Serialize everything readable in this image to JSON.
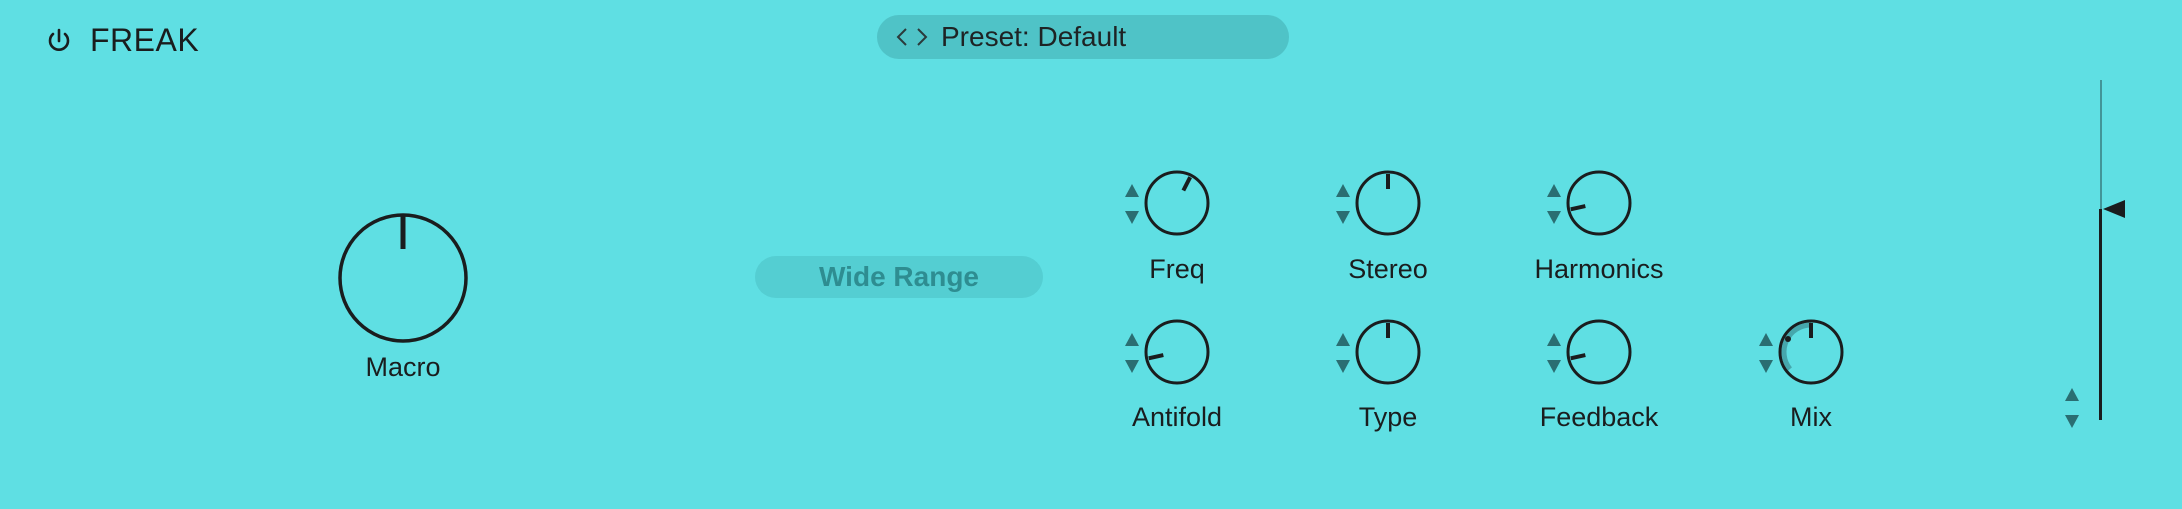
{
  "header": {
    "app_title": "FREAK",
    "preset_label": "Preset: Default"
  },
  "macro": {
    "label": "Macro",
    "value": 0.5
  },
  "wide_range": {
    "label": "Wide Range"
  },
  "knobs": {
    "freq": {
      "label": "Freq",
      "value": 0.6
    },
    "stereo": {
      "label": "Stereo",
      "value": 0.5
    },
    "harmonics": {
      "label": "Harmonics",
      "value": 0.12
    },
    "antifold": {
      "label": "Antifold",
      "value": 0.12
    },
    "type": {
      "label": "Type",
      "value": 0.5
    },
    "feedback": {
      "label": "Feedback",
      "value": 0.12
    },
    "mix": {
      "label": "Mix",
      "value": 0.5
    }
  },
  "output": {
    "level": 0.62
  },
  "colors": {
    "background": "#5fdfe3",
    "ink": "#1a1d1e",
    "accent_muted": "#2e8d91"
  },
  "icons": {
    "power": "power-icon",
    "prev": "chevron-left-icon",
    "next": "chevron-right-icon",
    "stepper": "up-down-arrows-icon"
  }
}
